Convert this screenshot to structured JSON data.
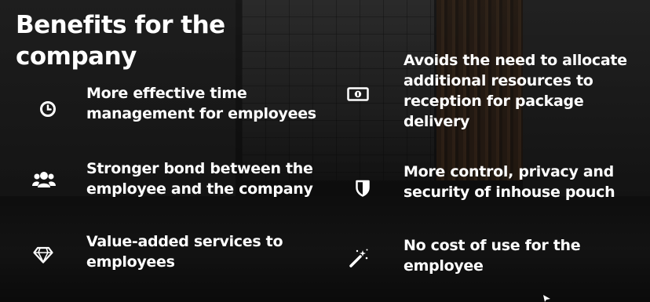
{
  "title": "Benefits for the company",
  "left_items": [
    {
      "icon": "clock-icon",
      "text": "More effective time management for employees"
    },
    {
      "icon": "users-icon",
      "text": "Stronger bond between the employee and the company"
    },
    {
      "icon": "diamond-icon",
      "text": "Value-added services to employees"
    }
  ],
  "right_items": [
    {
      "icon": "money-icon",
      "text": "Avoids the need to allocate additional resources to reception for package delivery"
    },
    {
      "icon": "shield-icon",
      "text": "More control, privacy and security of inhouse pouch"
    },
    {
      "icon": "magic-wand-icon",
      "text": "No cost of use for the employee"
    }
  ]
}
